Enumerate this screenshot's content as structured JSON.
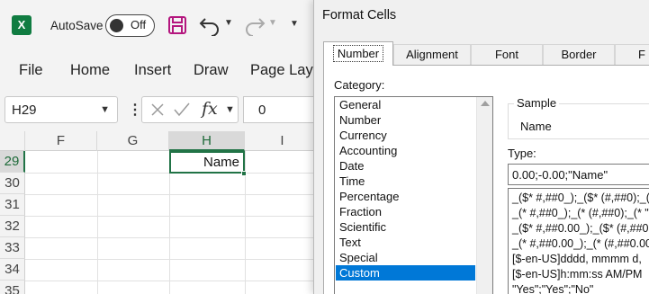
{
  "app": {
    "autosave_label": "AutoSave",
    "autosave_state": "Off",
    "colors": {
      "excel_green": "#217346",
      "selection_blue": "#0078d7"
    }
  },
  "menu": {
    "items": [
      "File",
      "Home",
      "Insert",
      "Draw",
      "Page Lay"
    ]
  },
  "formula_bar": {
    "name_box": "H29",
    "value": "0"
  },
  "grid": {
    "columns": [
      "F",
      "G",
      "H",
      "I"
    ],
    "rows": [
      "29",
      "30",
      "31",
      "32",
      "33",
      "34",
      "35"
    ],
    "active_cell_value": "Name"
  },
  "dialog": {
    "title": "Format Cells",
    "tabs": [
      "Number",
      "Alignment",
      "Font",
      "Border",
      "F"
    ],
    "category_label": "Category:",
    "categories": [
      "General",
      "Number",
      "Currency",
      "Accounting",
      "Date",
      "Time",
      "Percentage",
      "Fraction",
      "Scientific",
      "Text",
      "Special",
      "Custom"
    ],
    "selected_category": "Custom",
    "sample_label": "Sample",
    "sample_value": "Name",
    "type_label": "Type:",
    "type_value": "0.00;-0.00;\"Name\"",
    "type_list": [
      "_($* #,##0_);_($* (#,##0);_($",
      "_(* #,##0_);_(* (#,##0);_(* \"-",
      "_($* #,##0.00_);_($* (#,##0.",
      "_(* #,##0.00_);_(* (#,##0.00",
      "[$-en-US]dddd, mmmm d,",
      "[$-en-US]h:mm:ss AM/PM",
      "\"Yes\";\"Yes\";\"No\""
    ]
  }
}
